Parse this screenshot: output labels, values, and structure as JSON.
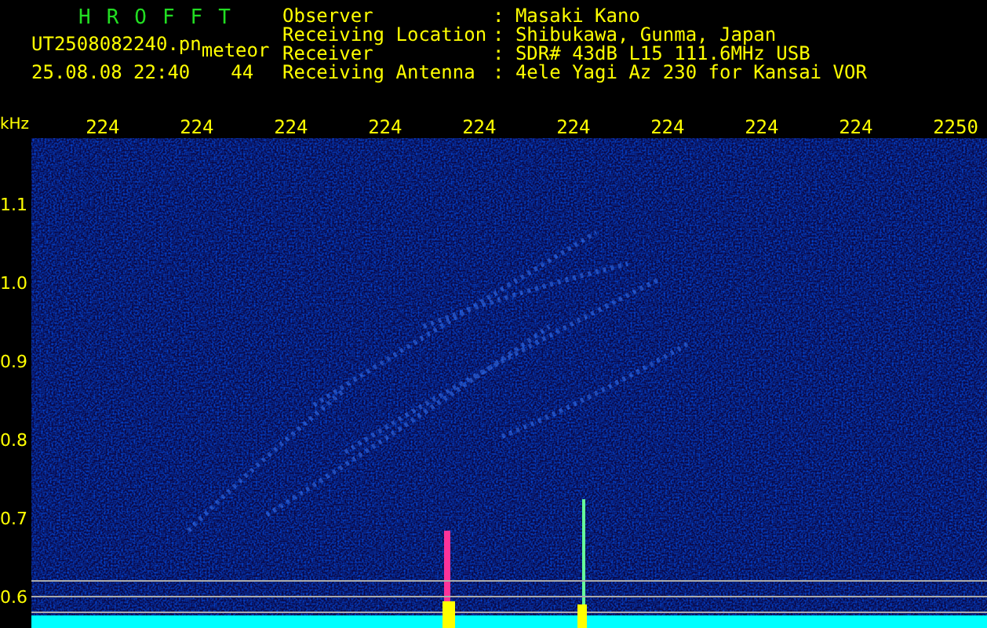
{
  "app_title": "HROFFT",
  "file_name": "UT2508082240.pn",
  "tag": "meteor",
  "timestamp": "25.08.08 22:40",
  "count": "44",
  "info": [
    {
      "label": "Observer",
      "value": ": Masaki Kano"
    },
    {
      "label": "Receiving Location",
      "value": ": Shibukawa, Gunma, Japan"
    },
    {
      "label": "Receiver",
      "value": ": SDR# 43dB L15 111.6MHz USB"
    },
    {
      "label": "Receiving Antenna",
      "value": ": 4ele Yagi Az 230 for Kansai VOR"
    }
  ],
  "y_unit": "kHz",
  "time_labels": [
    "224",
    "224",
    "224",
    "224",
    "224",
    "224",
    "224",
    "224",
    "224",
    "2250"
  ],
  "y_labels": [
    "1.1",
    "1.0",
    "0.9",
    "0.8",
    "0.7",
    "0.6"
  ]
}
